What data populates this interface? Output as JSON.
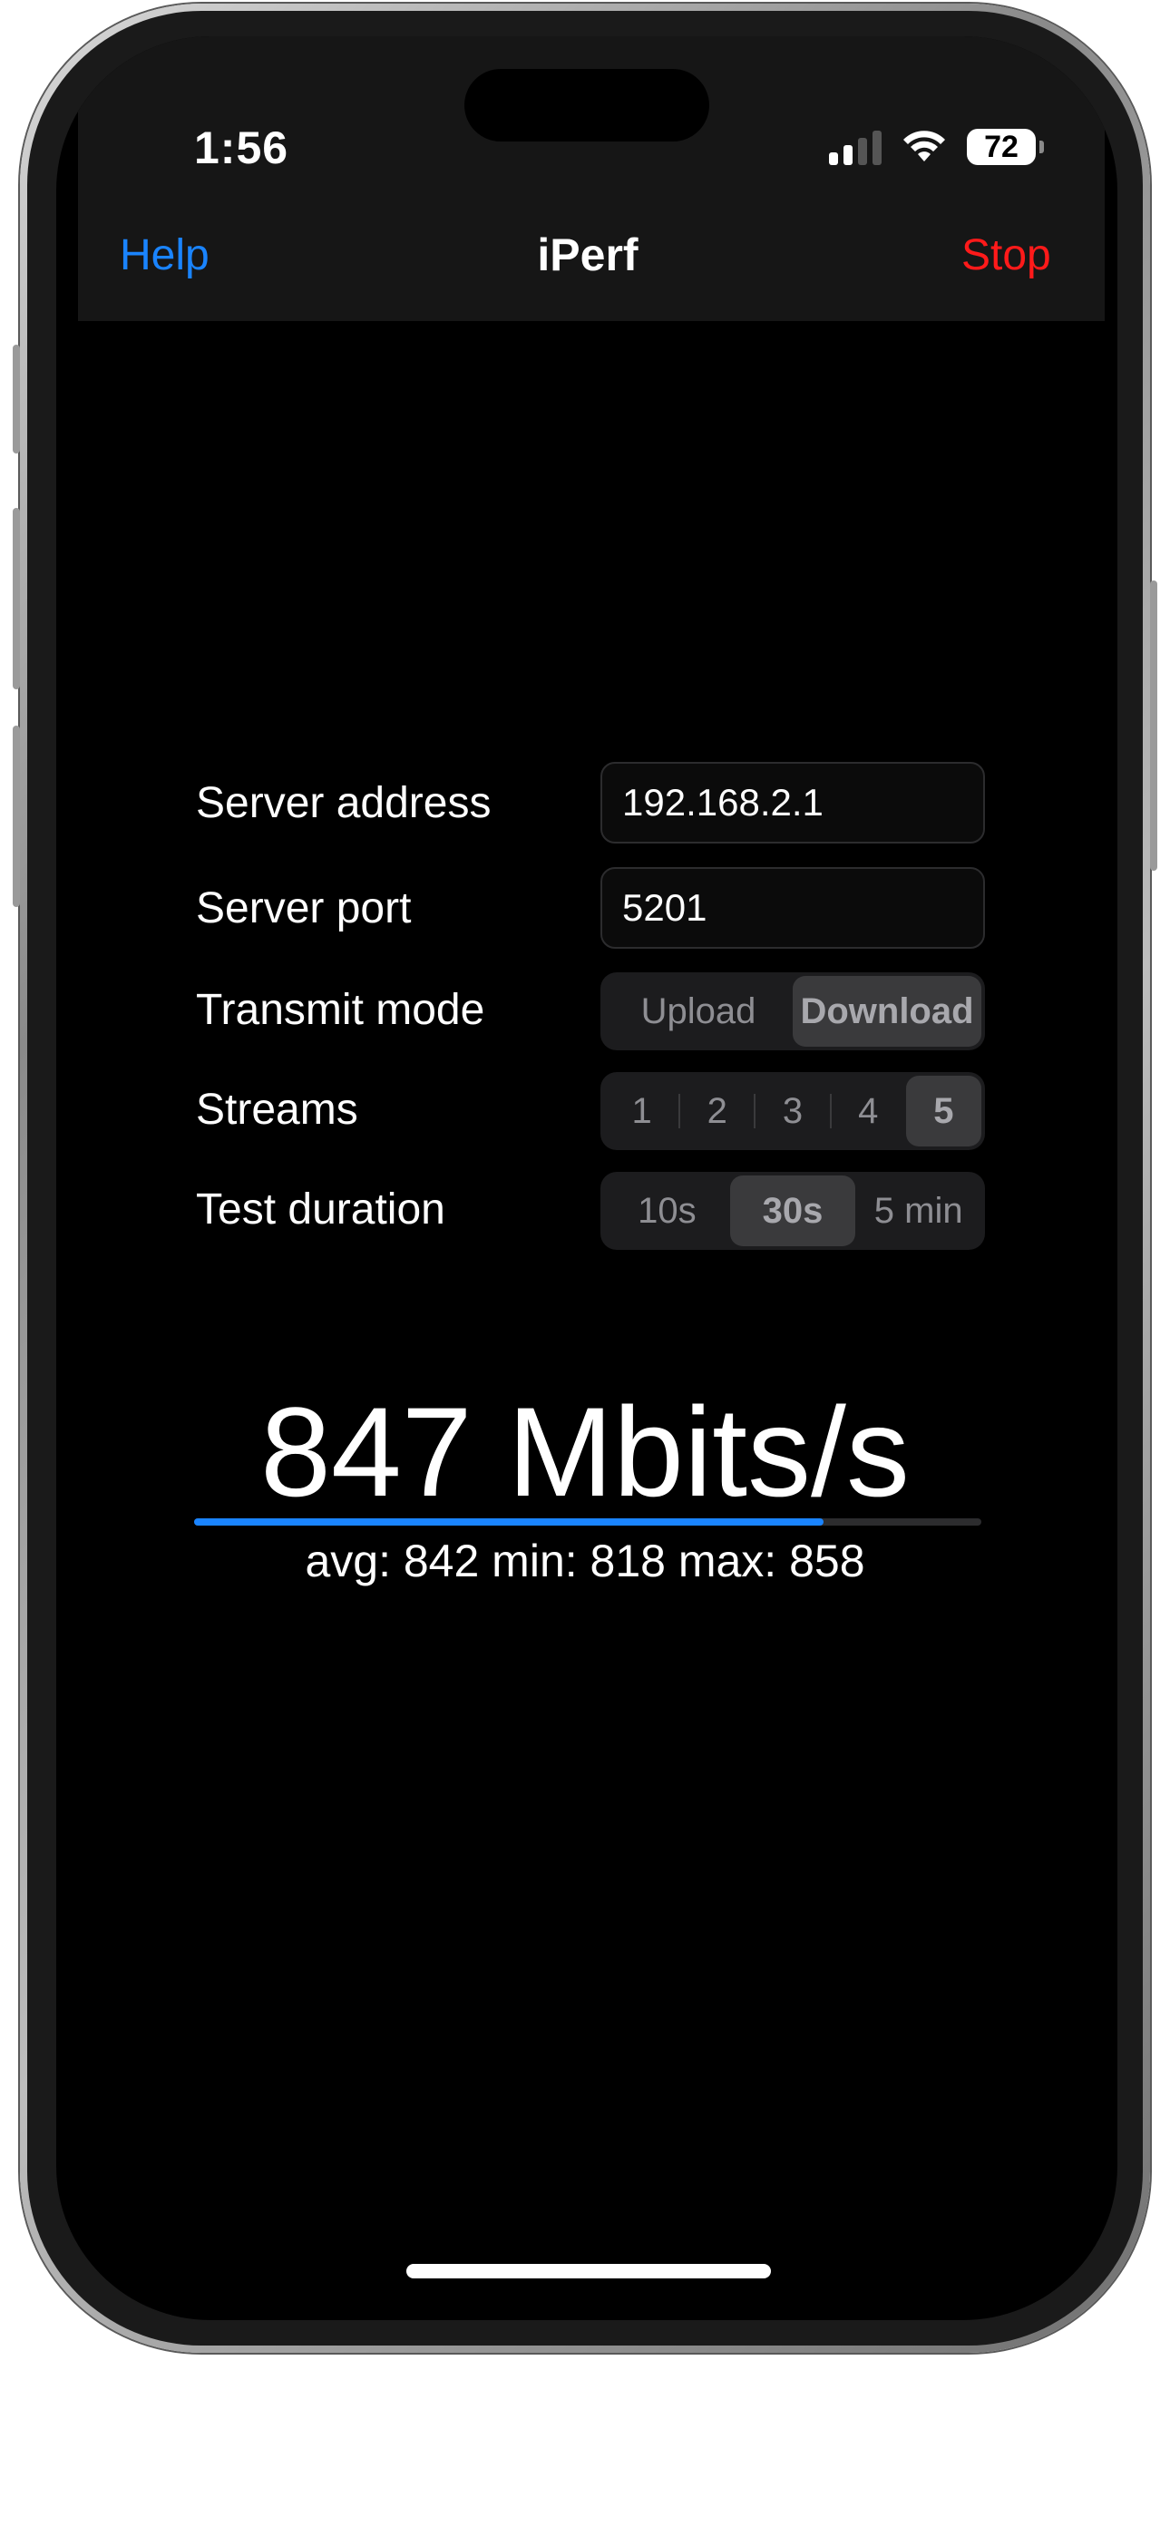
{
  "status_bar": {
    "time": "1:56",
    "battery": "72",
    "signal_icon": "cellular-signal-icon",
    "wifi_icon": "wifi-icon",
    "battery_icon": "battery-icon"
  },
  "nav": {
    "left": "Help",
    "title": "iPerf",
    "right": "Stop",
    "left_color": "#1a84ff",
    "right_color": "#ff1a1a"
  },
  "form": {
    "server_address": {
      "label": "Server address",
      "value": "192.168.2.1"
    },
    "server_port": {
      "label": "Server port",
      "value": "5201"
    },
    "transmit_mode": {
      "label": "Transmit mode",
      "options": [
        "Upload",
        "Download"
      ],
      "selected": "Download"
    },
    "streams": {
      "label": "Streams",
      "options": [
        "1",
        "2",
        "3",
        "4",
        "5"
      ],
      "selected": "5"
    },
    "test_duration": {
      "label": "Test duration",
      "options": [
        "10s",
        "30s",
        "5 min"
      ],
      "selected": "30s"
    }
  },
  "result": {
    "speed": "847 Mbits/s",
    "stats": "avg: 842 min: 818 max: 858",
    "progress": 0.8,
    "progress_color": "#1a84ff"
  }
}
